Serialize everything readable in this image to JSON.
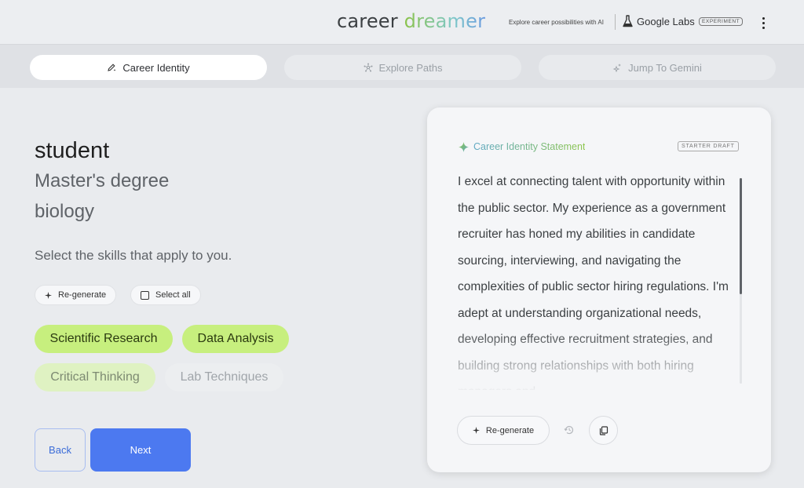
{
  "header": {
    "brand_word1": "career ",
    "brand_word2": "dreamer",
    "tagline": "Explore career possibilities with AI",
    "labs_label": "Google Labs",
    "experiment_badge": "EXPERIMENT"
  },
  "tabs": [
    {
      "label": "Career Identity",
      "icon": "pencil-sparkle-icon",
      "active": true
    },
    {
      "label": "Explore Paths",
      "icon": "network-icon",
      "active": false
    },
    {
      "label": "Jump To Gemini",
      "icon": "sparkle-icon",
      "active": false
    }
  ],
  "profile": {
    "role": "student",
    "degree": "Master's degree",
    "field": "biology"
  },
  "skills": {
    "prompt": "Select the skills that apply to you.",
    "regenerate_label": "Re-generate",
    "select_all_label": "Select all",
    "chips": [
      {
        "label": "Scientific Research",
        "selected": true
      },
      {
        "label": "Data Analysis",
        "selected": true
      },
      {
        "label": "Critical Thinking",
        "selected": false
      },
      {
        "label": "Lab Techniques",
        "selected": false
      }
    ]
  },
  "nav": {
    "back_label": "Back",
    "next_label": "Next"
  },
  "statement_card": {
    "heading": "Career Identity Statement",
    "badge": "STARTER DRAFT",
    "text": "I excel at connecting talent with opportunity within the public sector. My experience as a government recruiter has honed my abilities in candidate sourcing, interviewing, and navigating the complexities of public sector hiring regulations. I'm adept at understanding organizational needs, developing effective recruitment strategies, and building strong relationships with both hiring managers and",
    "regenerate_label": "Re-generate"
  },
  "colors": {
    "accent_blue": "#4c79f0",
    "chip_green": "#c7ef7e",
    "background": "#e9ebee"
  }
}
